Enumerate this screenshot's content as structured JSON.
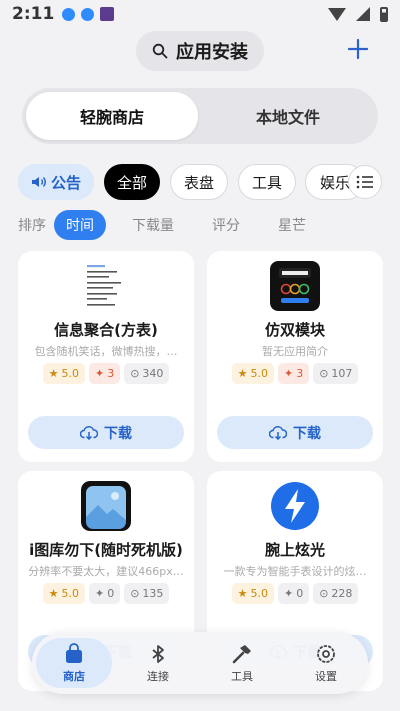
{
  "statusbar": {
    "time": "2:11"
  },
  "header": {
    "search_label": "应用安装",
    "search_icon": "search-icon",
    "add_icon": "plus-icon"
  },
  "tabs": [
    {
      "label": "轻腕商店"
    },
    {
      "label": "本地文件"
    }
  ],
  "chips": {
    "notice": "公告",
    "items": [
      "全部",
      "表盘",
      "工具",
      "娱乐"
    ]
  },
  "sort": {
    "label": "排序",
    "options": [
      "时间",
      "下载量",
      "评分",
      "星芒"
    ]
  },
  "cards": [
    {
      "name": "信息聚合(方表)",
      "desc": "包含随机笑话，微博热搜，…",
      "rating": "5.0",
      "hot": "3",
      "downloads": "340",
      "button": "下载"
    },
    {
      "name": "仿双模块",
      "desc": "暂无应用简介",
      "rating": "5.0",
      "hot": "3",
      "downloads": "107",
      "button": "下载"
    },
    {
      "name": "i图库勿下(随时死机版)",
      "desc": "分辨率不要太大，建议466px…",
      "rating": "5.0",
      "hot": "0",
      "downloads": "135",
      "button": "下载"
    },
    {
      "name": "腕上炫光",
      "desc": "一款专为智能手表设计的炫…",
      "rating": "5.0",
      "hot": "0",
      "downloads": "228",
      "button": "下载"
    }
  ],
  "nav": [
    {
      "label": "商店"
    },
    {
      "label": "连接"
    },
    {
      "label": "工具"
    },
    {
      "label": "设置"
    }
  ],
  "colors": {
    "accent": "#2f7ff0",
    "accent_soft": "#dbe9fb",
    "background": "#f2f2f5",
    "star": "#c98a10"
  }
}
